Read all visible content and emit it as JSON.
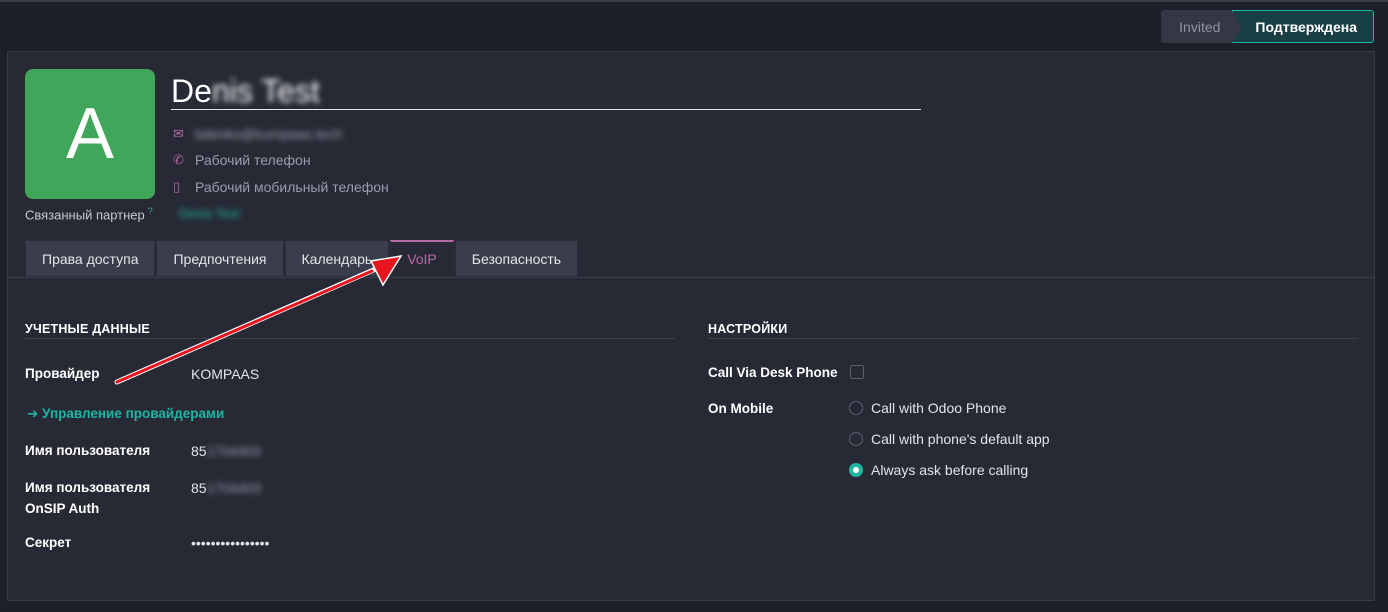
{
  "status": {
    "stages": [
      "Invited",
      "Подтверждена"
    ],
    "current": "Подтверждена"
  },
  "user": {
    "avatar_letter": "A",
    "name_visible": "De",
    "name_blurred": "nis Test",
    "email": "bdenko@kompaas.tech",
    "work_phone_placeholder": "Рабочий телефон",
    "mobile_phone_placeholder": "Рабочий мобильный телефон",
    "partner_label": "Связанный партнер",
    "partner_help": "?",
    "partner_value": "Denis Test"
  },
  "tabs": [
    {
      "label": "Права доступа",
      "active": false
    },
    {
      "label": "Предпочтения",
      "active": false
    },
    {
      "label": "Календарь",
      "active": false
    },
    {
      "label": "VoIP",
      "active": true
    },
    {
      "label": "Безопасность",
      "active": false
    }
  ],
  "credentials": {
    "title": "УЧЕТНЫЕ ДАННЫЕ",
    "provider_label": "Провайдер",
    "provider_value": "KOMPAAS",
    "manage_link": "➔ Управление провайдерами",
    "username_label": "Имя пользователя",
    "username_visible": "85",
    "username_blurred": "1704403",
    "auth_label_line1": "Имя пользователя",
    "auth_label_line2": "OnSIP Auth",
    "auth_visible": "85",
    "auth_blurred": "1704403",
    "secret_label": "Секрет",
    "secret_value": "••••••••••••••••"
  },
  "settings": {
    "title": "НАСТРОЙКИ",
    "desk_phone_label": "Call Via Desk Phone",
    "desk_phone_checked": false,
    "on_mobile_label": "On Mobile",
    "mobile_options": [
      {
        "label": "Call with Odoo Phone",
        "selected": false
      },
      {
        "label": "Call with phone's default app",
        "selected": false
      },
      {
        "label": "Always ask before calling",
        "selected": true
      }
    ]
  },
  "colors": {
    "accent": "#1fb5a3",
    "tab_active": "#b768a6",
    "avatar": "#3fa65a",
    "arrow": "#e8141e"
  }
}
